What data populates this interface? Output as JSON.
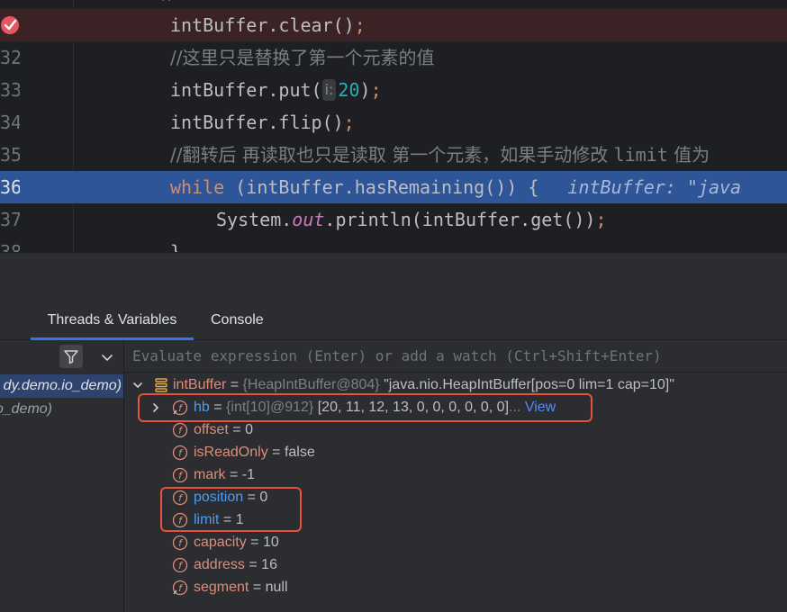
{
  "editor": {
    "cut_top_text": "//        ",
    "lines": [
      {
        "number": "",
        "code": "intBuffer.clear",
        "kind": "breakpoint"
      },
      {
        "number": "32",
        "comment": "//这里只是替换了第一个元素的值",
        "kind": "comment"
      },
      {
        "number": "33",
        "code": "intBuffer.put(",
        "hint": "i:",
        "arg": "20",
        "kind": "put"
      },
      {
        "number": "34",
        "code": "intBuffer.flip",
        "kind": "call"
      },
      {
        "number": "35",
        "comment_a": "//翻转后 再读取也只是读取 第一个元素，如果手动修改 ",
        "comment_mono": "limit",
        "comment_b": " 值为",
        "kind": "comment2"
      },
      {
        "number": "36",
        "keyword": "while",
        "code": " (intBuffer.hasRemaining()) {",
        "inline_value": "intBuffer: \"java",
        "kind": "exec"
      },
      {
        "number": "37",
        "code_a": "System.",
        "static_field": "out",
        "code_b": ".println(intBuffer.get())",
        "kind": "println"
      },
      {
        "number": "38",
        "code": "}",
        "kind": "partial"
      }
    ],
    "semicolon": ";",
    "parens": "()"
  },
  "debug": {
    "tabs": [
      {
        "label": "Threads & Variables",
        "active": true
      },
      {
        "label": "Console",
        "active": false
      }
    ],
    "frames": [
      {
        "label": "dy.demo.io_demo)",
        "selected": true
      },
      {
        "label": "o_demo)",
        "selected": false
      }
    ],
    "evaluate_placeholder": "Evaluate expression (Enter) or add a watch (Ctrl+Shift+Enter)",
    "root": {
      "name": "intBuffer",
      "ref": "{HeapIntBuffer@804}",
      "value": "\"java.nio.HeapIntBuffer[pos=0 lim=1 cap=10]\""
    },
    "fields": [
      {
        "name": "hb",
        "ref": "{int[10]@912}",
        "value": "[20, 11, 12, 13, 0, 0, 0, 0, 0, 0]",
        "suffix": "...",
        "link": "View",
        "expandable": true,
        "highlight": "blue"
      },
      {
        "name": "offset",
        "value": "0"
      },
      {
        "name": "isReadOnly",
        "value": "false"
      },
      {
        "name": "mark",
        "value": "-1"
      },
      {
        "name": "position",
        "value": "0",
        "highlight": "blue"
      },
      {
        "name": "limit",
        "value": "1",
        "highlight": "blue"
      },
      {
        "name": "capacity",
        "value": "10"
      },
      {
        "name": "address",
        "value": "16"
      },
      {
        "name": "segment",
        "value": "null"
      }
    ],
    "equals": "="
  },
  "colors": {
    "editor_bg": "#1e1f22",
    "panel_bg": "#2b2d30",
    "execution_line": "#2e5597",
    "breakpoint_line": "#3b2325",
    "breakpoint": "#e55765",
    "keyword": "#cf8e6d",
    "number": "#2aacb8",
    "field_name": "#dd8e7b",
    "changed_field": "#4e9cf0",
    "annotation_box": "#e8513c",
    "tab_underline": "#3574f0"
  },
  "icons": [
    "breakpoint-check-icon",
    "filter-icon",
    "chevron-down-icon",
    "expand-arrow-icon",
    "field-icon",
    "watch-list-icon"
  ]
}
